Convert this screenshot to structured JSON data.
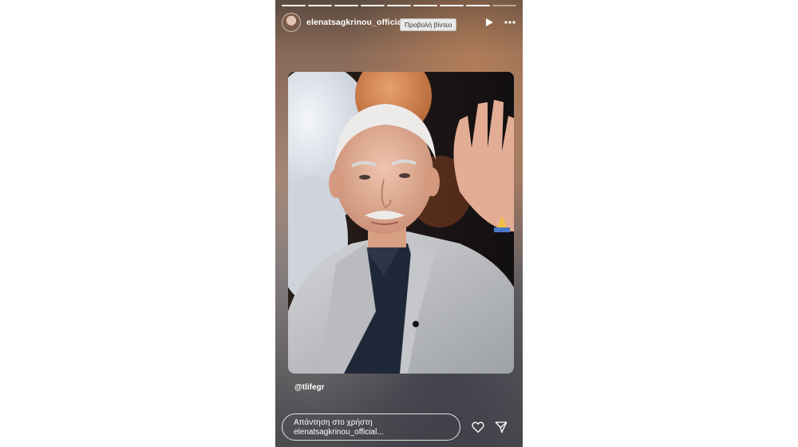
{
  "story": {
    "username": "elenatsagkrinou_official",
    "tooltip": "Προβολή βίντεο",
    "progress_segments_total": 9,
    "progress_segments_done": 8,
    "mention": "@tlifegr",
    "reply_placeholder_line1": "Απάντηση στο χρήστη",
    "reply_placeholder_line2": "elenatsagkrinou_official...",
    "icons": {
      "header": [
        "play-icon",
        "more-options-icon"
      ],
      "footer": [
        "heart-icon",
        "send-icon"
      ]
    }
  }
}
